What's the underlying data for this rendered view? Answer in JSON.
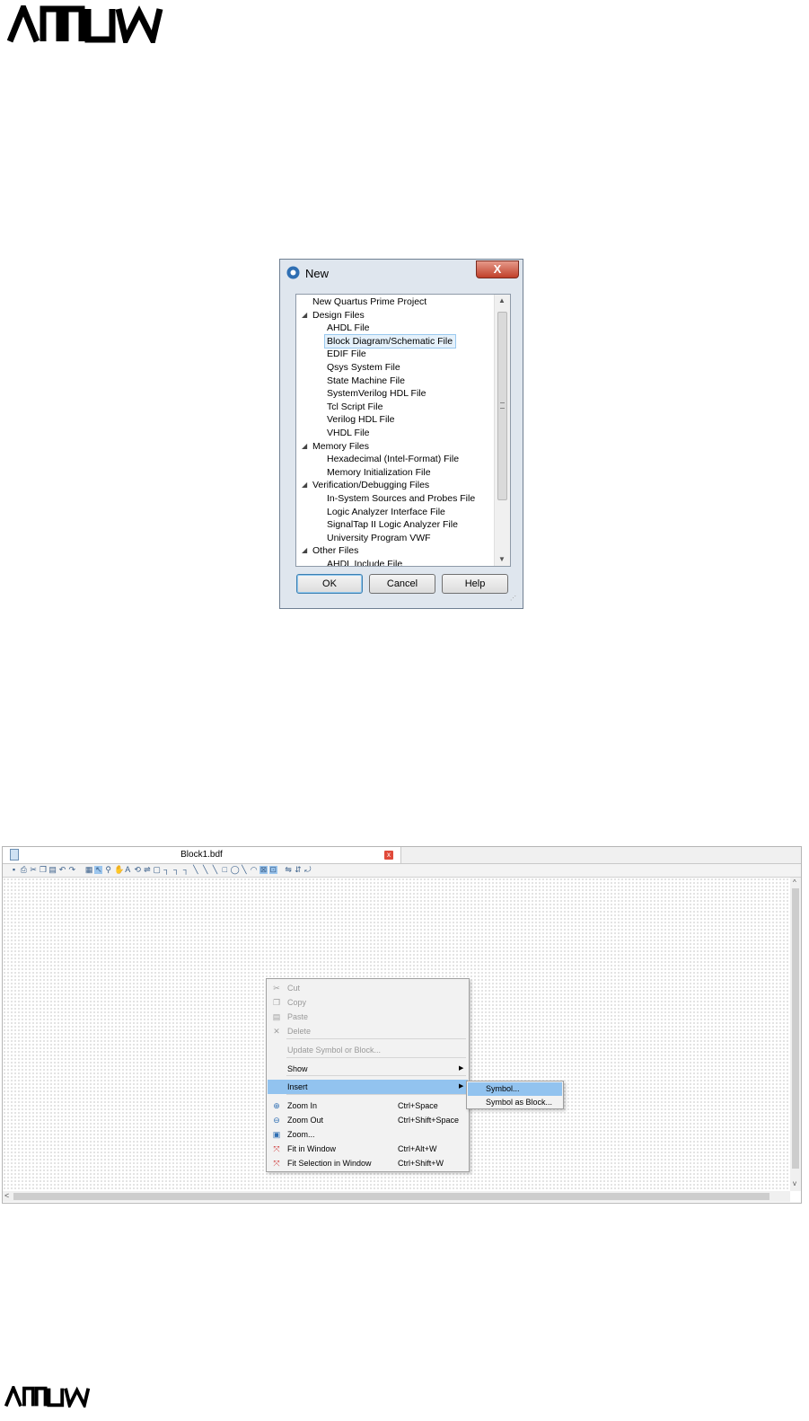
{
  "brand": {
    "logo_text": "ARROW"
  },
  "new_dialog": {
    "title": "New",
    "close_glyph": "X",
    "tree": [
      {
        "label": "New Quartus Prime Project",
        "level": 0,
        "expanded": null,
        "selected": false
      },
      {
        "label": "Design Files",
        "level": 0,
        "expanded": true,
        "selected": false
      },
      {
        "label": "AHDL File",
        "level": 1,
        "expanded": null,
        "selected": false
      },
      {
        "label": "Block Diagram/Schematic File",
        "level": 1,
        "expanded": null,
        "selected": true
      },
      {
        "label": "EDIF File",
        "level": 1,
        "expanded": null,
        "selected": false
      },
      {
        "label": "Qsys System File",
        "level": 1,
        "expanded": null,
        "selected": false
      },
      {
        "label": "State Machine File",
        "level": 1,
        "expanded": null,
        "selected": false
      },
      {
        "label": "SystemVerilog HDL File",
        "level": 1,
        "expanded": null,
        "selected": false
      },
      {
        "label": "Tcl Script File",
        "level": 1,
        "expanded": null,
        "selected": false
      },
      {
        "label": "Verilog HDL File",
        "level": 1,
        "expanded": null,
        "selected": false
      },
      {
        "label": "VHDL File",
        "level": 1,
        "expanded": null,
        "selected": false
      },
      {
        "label": "Memory Files",
        "level": 0,
        "expanded": true,
        "selected": false
      },
      {
        "label": "Hexadecimal (Intel-Format) File",
        "level": 1,
        "expanded": null,
        "selected": false
      },
      {
        "label": "Memory Initialization File",
        "level": 1,
        "expanded": null,
        "selected": false
      },
      {
        "label": "Verification/Debugging Files",
        "level": 0,
        "expanded": true,
        "selected": false
      },
      {
        "label": "In-System Sources and Probes File",
        "level": 1,
        "expanded": null,
        "selected": false
      },
      {
        "label": "Logic Analyzer Interface File",
        "level": 1,
        "expanded": null,
        "selected": false
      },
      {
        "label": "SignalTap II Logic Analyzer File",
        "level": 1,
        "expanded": null,
        "selected": false
      },
      {
        "label": "University Program VWF",
        "level": 1,
        "expanded": null,
        "selected": false
      },
      {
        "label": "Other Files",
        "level": 0,
        "expanded": true,
        "selected": false
      },
      {
        "label": "AHDL Include File",
        "level": 1,
        "expanded": null,
        "selected": false
      }
    ],
    "buttons": {
      "ok": "OK",
      "cancel": "Cancel",
      "help": "Help"
    }
  },
  "editor": {
    "tab_title": "Block1.bdf",
    "tab_close_glyph": "x",
    "toolbar_icons": [
      "save-icon",
      "print-icon",
      "cut-icon",
      "copy-icon",
      "paste-icon",
      "undo-icon",
      "redo-icon",
      "symbol-tool-icon",
      "selection-tool-icon",
      "zoom-tool-icon",
      "hand-tool-icon",
      "text-tool-icon",
      "symbol-insert-icon",
      "pin-tool-icon",
      "block-tool-icon",
      "orthogonal-node-icon",
      "orthogonal-bus-icon",
      "orthogonal-conduit-icon",
      "diagonal-node-icon",
      "diagonal-bus-icon",
      "diagonal-conduit-icon",
      "rectangle-icon",
      "oval-icon",
      "line-icon",
      "arc-icon",
      "rubberbanding-icon",
      "partial-line-icon",
      "flip-horizontal-icon",
      "flip-vertical-icon",
      "rotate-icon"
    ],
    "context_menu": {
      "items": [
        {
          "label": "Cut",
          "shortcut": "",
          "icon": "cut-icon",
          "disabled": true,
          "highlighted": false,
          "submenu": false
        },
        {
          "label": "Copy",
          "shortcut": "",
          "icon": "copy-icon",
          "disabled": true,
          "highlighted": false,
          "submenu": false
        },
        {
          "label": "Paste",
          "shortcut": "",
          "icon": "paste-icon",
          "disabled": true,
          "highlighted": false,
          "submenu": false
        },
        {
          "label": "Delete",
          "shortcut": "",
          "icon": "delete-icon",
          "disabled": true,
          "highlighted": false,
          "submenu": false
        },
        {
          "label": "Update Symbol or Block...",
          "shortcut": "",
          "icon": "",
          "disabled": true,
          "highlighted": false,
          "submenu": false
        },
        {
          "label": "Show",
          "shortcut": "",
          "icon": "",
          "disabled": false,
          "highlighted": false,
          "submenu": true
        },
        {
          "label": "Insert",
          "shortcut": "",
          "icon": "",
          "disabled": false,
          "highlighted": true,
          "submenu": true
        },
        {
          "label": "Zoom In",
          "shortcut": "Ctrl+Space",
          "icon": "zoom-in-icon",
          "disabled": false,
          "highlighted": false,
          "submenu": false
        },
        {
          "label": "Zoom Out",
          "shortcut": "Ctrl+Shift+Space",
          "icon": "zoom-out-icon",
          "disabled": false,
          "highlighted": false,
          "submenu": false
        },
        {
          "label": "Zoom...",
          "shortcut": "",
          "icon": "zoom-icon",
          "disabled": false,
          "highlighted": false,
          "submenu": false
        },
        {
          "label": "Fit in Window",
          "shortcut": "Ctrl+Alt+W",
          "icon": "fit-window-icon",
          "disabled": false,
          "highlighted": false,
          "submenu": false
        },
        {
          "label": "Fit Selection in Window",
          "shortcut": "Ctrl+Shift+W",
          "icon": "fit-selection-icon",
          "disabled": false,
          "highlighted": false,
          "submenu": false
        }
      ],
      "submenu_items": [
        {
          "label": "Symbol...",
          "highlighted": true
        },
        {
          "label": "Symbol as Block...",
          "highlighted": false
        }
      ]
    }
  },
  "colors": {
    "highlight": "#92c3ef",
    "brand": "#000000"
  }
}
